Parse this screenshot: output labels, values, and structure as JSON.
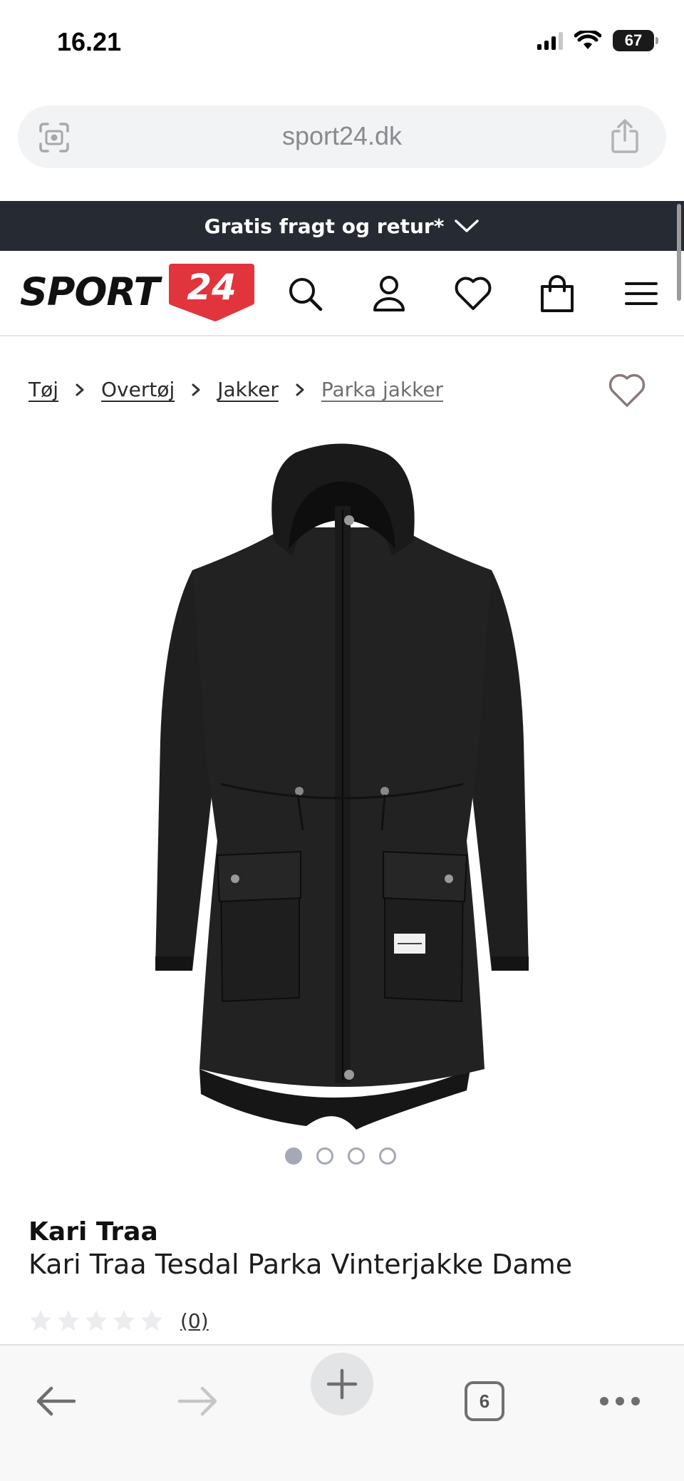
{
  "status_bar": {
    "time": "16.21",
    "battery": "67"
  },
  "browser": {
    "url": "sport24.dk",
    "tabs_count": "6"
  },
  "promo": {
    "text": "Gratis fragt og retur*"
  },
  "logo": {
    "word": "SPORT",
    "number": "24"
  },
  "header_icons": [
    "search-icon",
    "account-icon",
    "heart-icon",
    "bag-icon",
    "menu-icon"
  ],
  "breadcrumb": {
    "items": [
      "Tøj",
      "Overtøj",
      "Jakker",
      "Parka jakker"
    ]
  },
  "carousel": {
    "slides": 4,
    "active_index": 0
  },
  "product": {
    "brand": "Kari Traa",
    "title": "Kari Traa Tesdal Parka Vinterjakke Dame",
    "rating_stars": 0,
    "review_count": "(0)"
  },
  "colors": {
    "banner_bg": "#262a33",
    "brand_red": "#e2343d",
    "coat": "#1c1c1c"
  }
}
